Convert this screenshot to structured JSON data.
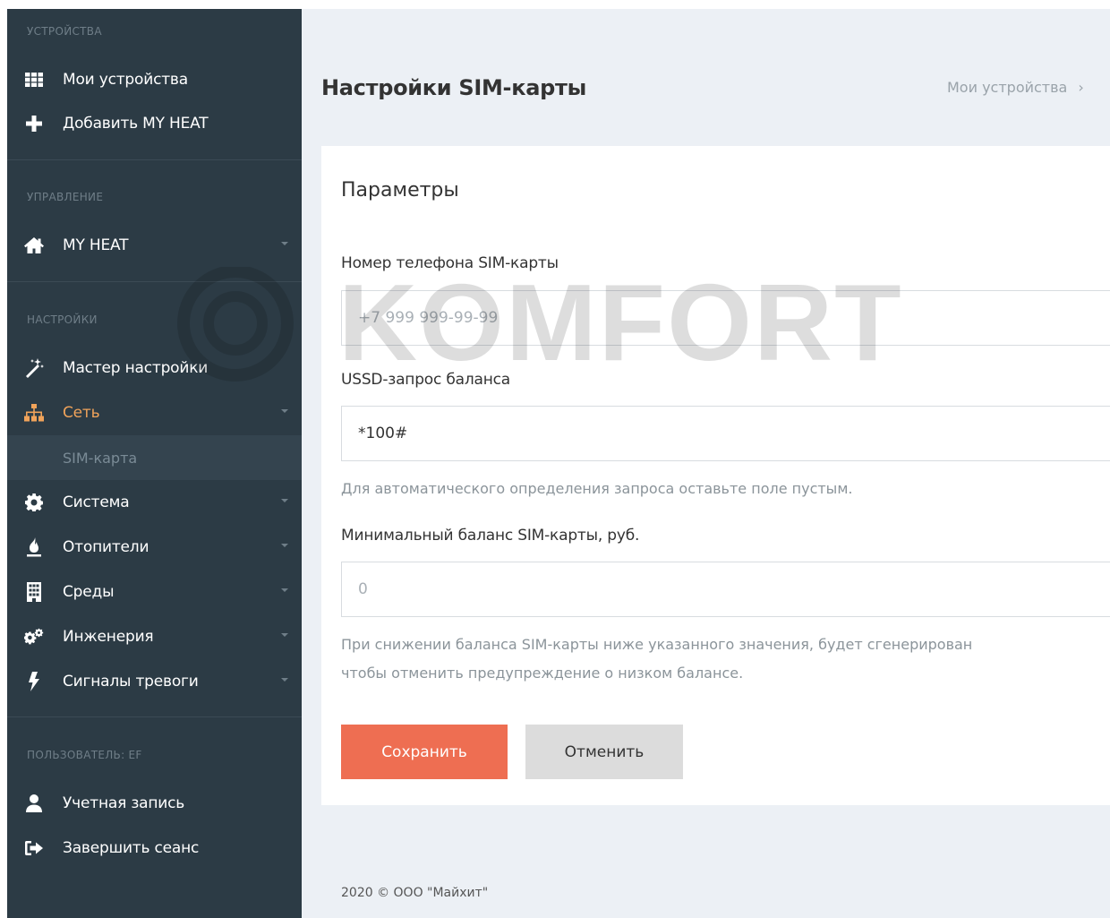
{
  "sidebar": {
    "sections": {
      "devices": "УСТРОЙСТВА",
      "control": "УПРАВЛЕНИЕ",
      "settings": "НАСТРОЙКИ",
      "user": "ПОЛЬЗОВАТЕЛЬ: EF"
    },
    "items": {
      "my_devices": "Мои устройства",
      "add_myheat": "Добавить MY HEAT",
      "myheat": "MY HEAT",
      "wizard": "Мастер настройки",
      "network": "Сеть",
      "sim_card": "SIM-карта",
      "system": "Система",
      "heaters": "Отопители",
      "environments": "Среды",
      "engineering": "Инженерия",
      "alarms": "Сигналы тревоги",
      "account": "Учетная запись",
      "logout": "Завершить сеанс"
    },
    "icons": {
      "my_devices": "grid-icon",
      "add_myheat": "plus-icon",
      "myheat": "home-icon",
      "wizard": "magic-wand-icon",
      "network": "sitemap-icon",
      "system": "gear-icon",
      "heaters": "fire-icon",
      "environments": "building-icon",
      "engineering": "gears-icon",
      "alarms": "bolt-icon",
      "account": "user-icon",
      "logout": "sign-out-icon"
    }
  },
  "header": {
    "title": "Настройки SIM-карты",
    "breadcrumb": "Мои устройства",
    "breadcrumb_sep": "›"
  },
  "form": {
    "title": "Параметры",
    "phone_label": "Номер телефона SIM-карты",
    "phone_placeholder": "+7 999 999-99-99",
    "phone_value": "",
    "ussd_label": "USSD-запрос баланса",
    "ussd_value": "*100#",
    "ussd_hint": "Для автоматического определения запроса оставьте поле пустым.",
    "min_balance_label": "Минимальный баланс SIM-карты, руб.",
    "min_balance_placeholder": "0",
    "min_balance_value": "",
    "min_balance_hint_line1": "При снижении баланса SIM-карты ниже указанного значения, будет сгенерирован",
    "min_balance_hint_line2": "чтобы отменить предупреждение о низком балансе.",
    "save_label": "Сохранить",
    "cancel_label": "Отменить"
  },
  "footer": {
    "text": "2020 © ООО \"Майхит\""
  },
  "watermark": {
    "text": "KOMFORT"
  },
  "colors": {
    "sidebar_bg": "#2c3b45",
    "accent_orange": "#f0a35a",
    "save_button": "#ee6e52",
    "page_bg": "#ecf0f5"
  }
}
